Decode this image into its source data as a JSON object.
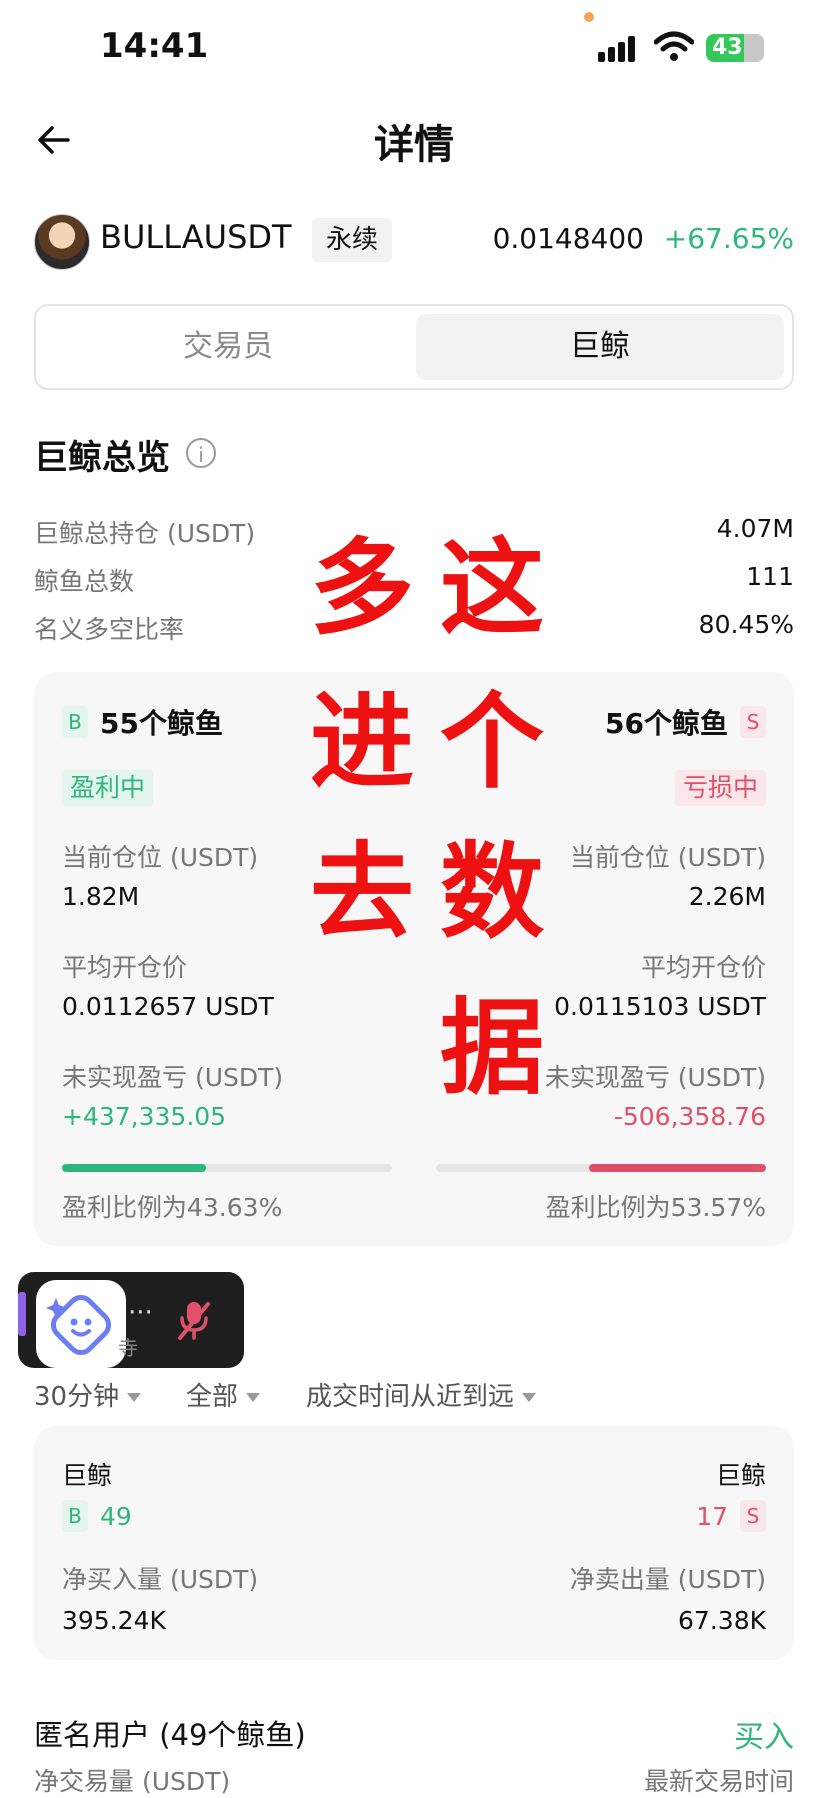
{
  "status_bar": {
    "time": "14:41",
    "battery": "43"
  },
  "header": {
    "title": "详情"
  },
  "ticker": {
    "symbol": "BULLAUSDT",
    "type": "永续",
    "price": "0.0148400",
    "change": "+67.65%"
  },
  "tabs": [
    {
      "label": "交易员"
    },
    {
      "label": "巨鲸"
    }
  ],
  "overview": {
    "title": "巨鲸总览",
    "rows": [
      {
        "label": "巨鲸总持仓 (USDT)",
        "value": "4.07M"
      },
      {
        "label": "鲸鱼总数",
        "value": "111"
      },
      {
        "label": "名义多空比率",
        "value": "80.45%"
      }
    ]
  },
  "long_side": {
    "badge": "B",
    "count": "55个鲸鱼",
    "status": "盈利中",
    "position_label": "当前仓位 (USDT)",
    "position_value": "1.82M",
    "entry_label": "平均开仓价",
    "entry_value": "0.0112657 USDT",
    "pnl_label": "未实现盈亏 (USDT)",
    "pnl_value": "+437,335.05",
    "profit_ratio": 0.4363,
    "ratio_text": "盈利比例为43.63%"
  },
  "short_side": {
    "badge": "S",
    "count": "56个鲸鱼",
    "status": "亏损中",
    "position_label": "当前仓位 (USDT)",
    "position_value": "2.26M",
    "entry_label": "平均开仓价",
    "entry_value": "0.0115103 USDT",
    "pnl_label": "未实现盈亏 (USDT)",
    "pnl_value": "-506,358.76",
    "profit_ratio": 0.5357,
    "ratio_text": "盈利比例为53.57%"
  },
  "overlay_text": {
    "c1": "多",
    "c2": "这",
    "c3": "进",
    "c4": "个",
    "c5": "去",
    "c6": "数",
    "c7": "据"
  },
  "floating_widget": {
    "dots": "···",
    "sub": "寺"
  },
  "filters": [
    {
      "label": "30分钟"
    },
    {
      "label": "全部"
    },
    {
      "label": "成交时间从近到远"
    }
  ],
  "flow_card": {
    "left_title": "巨鲸",
    "left_badge": "B",
    "left_count": "49",
    "right_title": "巨鲸",
    "right_badge": "S",
    "right_count": "17",
    "buy_label": "净买入量 (USDT)",
    "buy_value": "395.24K",
    "sell_label": "净卖出量 (USDT)",
    "sell_value": "67.38K"
  },
  "anon": {
    "title": "匿名用户 (49个鲸鱼)",
    "action": "买入",
    "volume_label": "净交易量 (USDT)",
    "time_label": "最新交易时间"
  },
  "colors": {
    "green": "#2fb67c",
    "red": "#e0506a",
    "overlay_red": "#ee1111"
  }
}
